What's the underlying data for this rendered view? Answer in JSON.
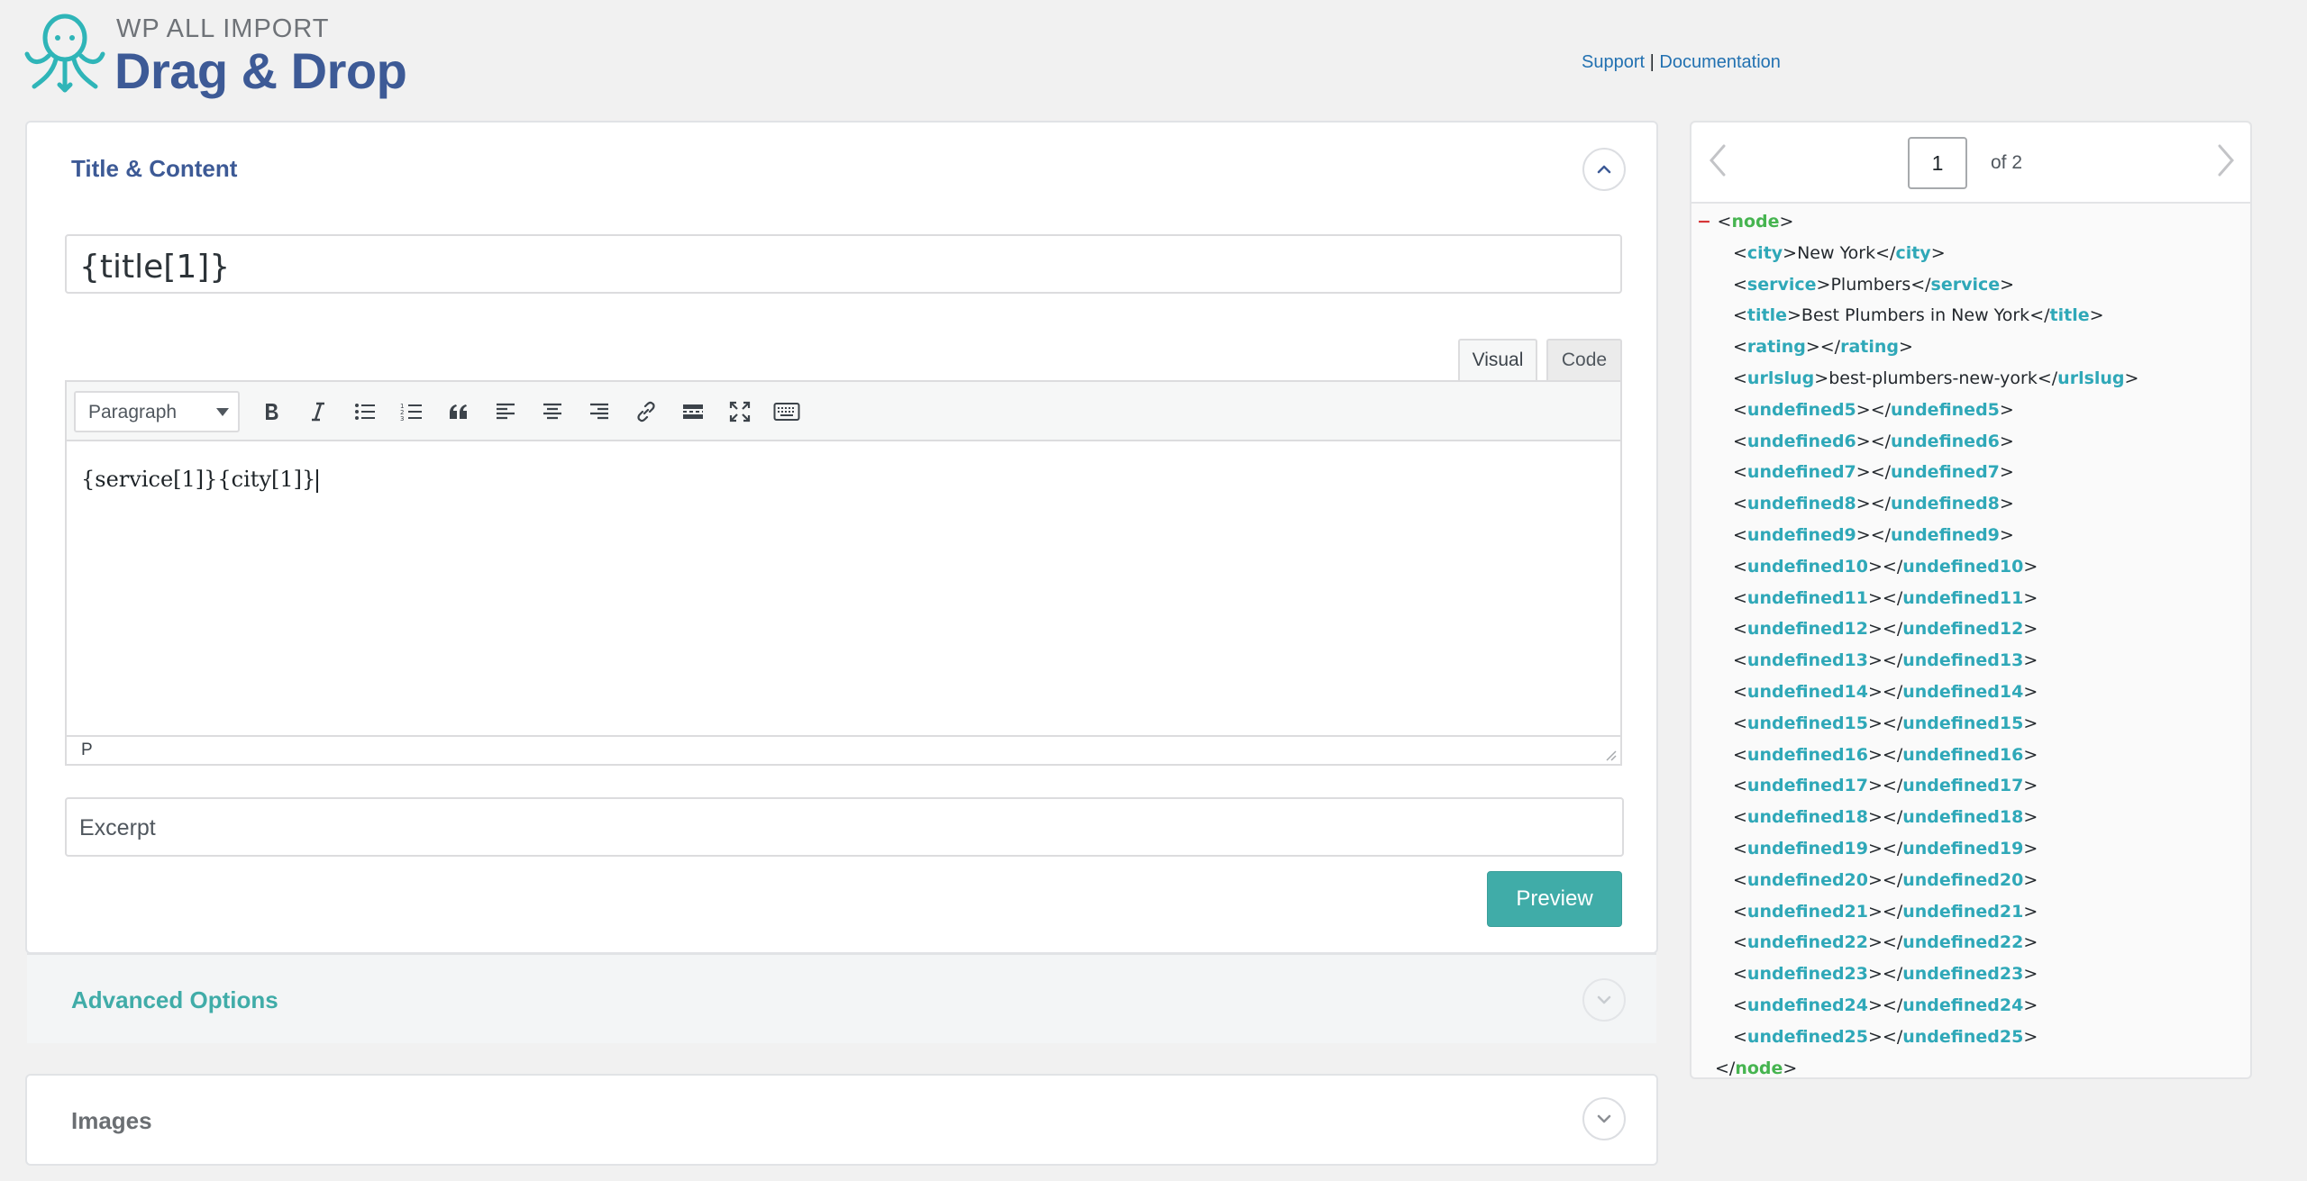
{
  "header": {
    "brand_top": "WP ALL IMPORT",
    "brand_main": "Drag & Drop",
    "support_link": "Support",
    "separator": "|",
    "documentation_link": "Documentation"
  },
  "title_content": {
    "heading": "Title & Content",
    "title_value": "{title[1]}",
    "tabs": {
      "visual": "Visual",
      "code": "Code"
    },
    "format_select": "Paragraph",
    "editor_content": "{service[1]}{city[1]}",
    "status_path": "P",
    "excerpt_placeholder": "Excerpt",
    "preview_button": "Preview"
  },
  "advanced": {
    "heading": "Advanced Options"
  },
  "images": {
    "heading": "Images"
  },
  "xml_viewer": {
    "page": "1",
    "of_label": "of 2",
    "root_tag": "node",
    "collapse_symbol": "−",
    "children": [
      {
        "tag": "city",
        "value": "New York"
      },
      {
        "tag": "service",
        "value": "Plumbers"
      },
      {
        "tag": "title",
        "value": "Best Plumbers in New York"
      },
      {
        "tag": "rating",
        "value": ""
      },
      {
        "tag": "urlslug",
        "value": "best-plumbers-new-york"
      },
      {
        "tag": "undefined5",
        "value": ""
      },
      {
        "tag": "undefined6",
        "value": ""
      },
      {
        "tag": "undefined7",
        "value": ""
      },
      {
        "tag": "undefined8",
        "value": ""
      },
      {
        "tag": "undefined9",
        "value": ""
      },
      {
        "tag": "undefined10",
        "value": ""
      },
      {
        "tag": "undefined11",
        "value": ""
      },
      {
        "tag": "undefined12",
        "value": ""
      },
      {
        "tag": "undefined13",
        "value": ""
      },
      {
        "tag": "undefined14",
        "value": ""
      },
      {
        "tag": "undefined15",
        "value": ""
      },
      {
        "tag": "undefined16",
        "value": ""
      },
      {
        "tag": "undefined17",
        "value": ""
      },
      {
        "tag": "undefined18",
        "value": ""
      },
      {
        "tag": "undefined19",
        "value": ""
      },
      {
        "tag": "undefined20",
        "value": ""
      },
      {
        "tag": "undefined21",
        "value": ""
      },
      {
        "tag": "undefined22",
        "value": ""
      },
      {
        "tag": "undefined23",
        "value": ""
      },
      {
        "tag": "undefined24",
        "value": ""
      },
      {
        "tag": "undefined25",
        "value": ""
      }
    ]
  },
  "colors": {
    "brand_blue": "#3d5a96",
    "teal_accent": "#40aca8",
    "link_blue": "#2271b1",
    "xml_tag_green": "#46b450",
    "xml_child_tag": "#2fa8b8"
  }
}
